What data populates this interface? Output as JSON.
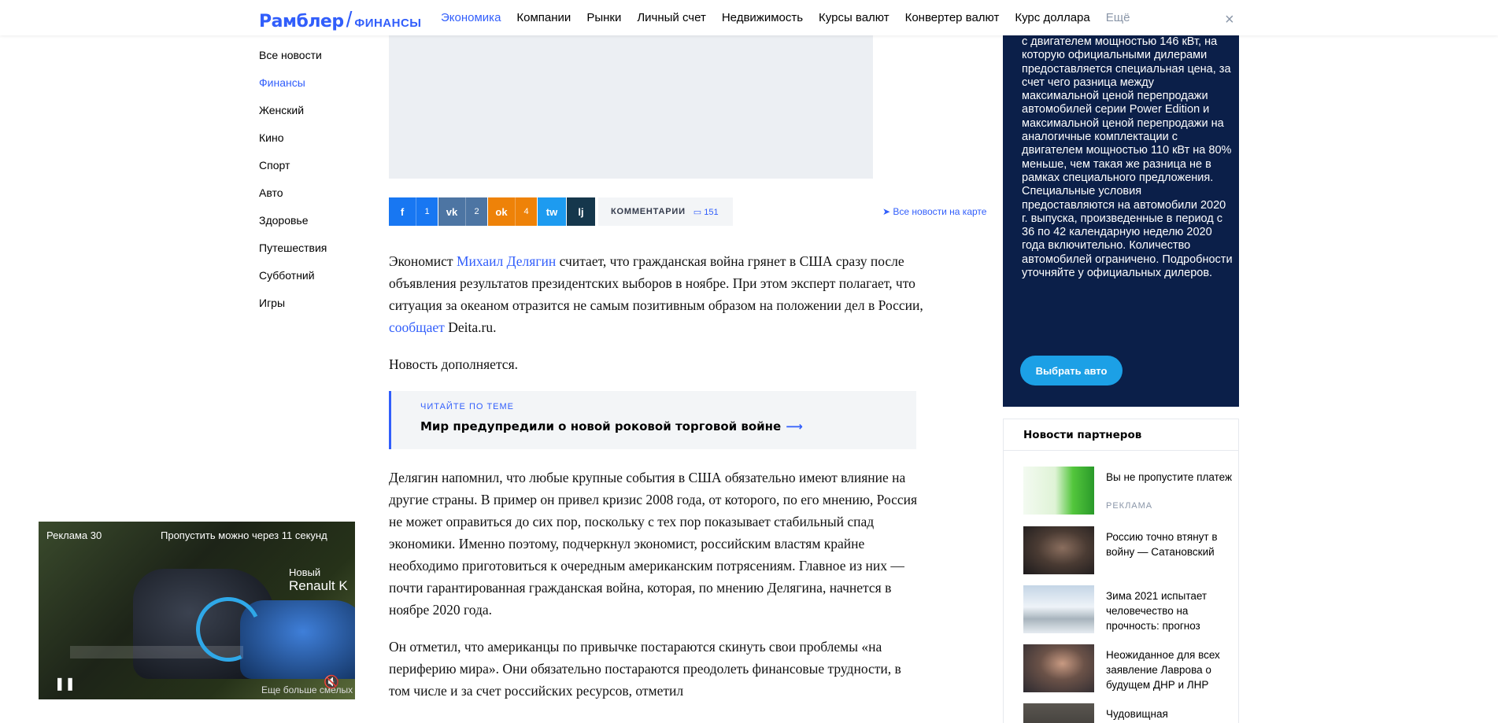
{
  "header": {
    "logo_main": "Рамблер",
    "logo_slash": "/",
    "logo_sub": "ФИНАНСЫ",
    "nav": [
      {
        "label": "Экономика",
        "active": true
      },
      {
        "label": "Компании"
      },
      {
        "label": "Рынки"
      },
      {
        "label": "Личный счет"
      },
      {
        "label": "Недвижимость"
      },
      {
        "label": "Курсы валют"
      },
      {
        "label": "Конвертер валют"
      },
      {
        "label": "Курс доллара"
      },
      {
        "label": "Ещё"
      }
    ],
    "close_icon": "×"
  },
  "sidebar": {
    "items": [
      {
        "label": "Все новости"
      },
      {
        "label": "Финансы",
        "active": true
      },
      {
        "label": "Женский"
      },
      {
        "label": "Кино"
      },
      {
        "label": "Спорт"
      },
      {
        "label": "Авто"
      },
      {
        "label": "Здоровье"
      },
      {
        "label": "Путешествия"
      },
      {
        "label": "Субботний"
      },
      {
        "label": "Игры"
      }
    ]
  },
  "share": {
    "fb_icon": "f",
    "fb_count": "1",
    "vk_icon": "vk",
    "vk_count": "2",
    "ok_icon": "ok",
    "ok_count": "4",
    "tw_icon": "tw",
    "lj_icon": "lj",
    "comments_label": "КОММЕНТАРИИ",
    "comments_count": "151",
    "map_link": "Все новости на карте"
  },
  "article": {
    "p1_a": "Экономист ",
    "p1_link1": "Михаил Делягин",
    "p1_b": " считает, что гражданская война грянет в США сразу после объявления результатов президентских выборов в ноябре. При этом эксперт полагает, что ситуация за океаном отразится не самым позитивным образом на положении дел в России, ",
    "p1_link2": "сообщает",
    "p1_c": " Deita.ru.",
    "p2": "Новость дополняется.",
    "read_also_title": "ЧИТАЙТЕ ПО ТЕМЕ",
    "read_also_link": "Мир предупредили о новой роковой торговой войне",
    "p3": "Делягин напомнил, что любые крупные события в США обязательно имеют влияние на другие страны. В пример он привел кризис 2008 года, от которого, по его мнению, Россия не может оправиться до сих пор, поскольку с тех пор показывает стабильный спад экономики. Именно поэтому, подчеркнул экономист, российским властям крайне необходимо приготовиться к очередным американским потрясениям. Главное из них — почти гарантированная гражданская война, которая, по мнению Делягина, начнется в ноябре 2020 года.",
    "p4": "Он отметил, что американцы по привычке постараются скинуть свои проблемы «на периферию мира». Они обязательно постараются преодолеть финансовые трудности, в том числе и за счет российских ресурсов, отметил"
  },
  "dark_ad": {
    "text": "с двигателем мощностью 146 кВт, на которую официальными дилерами предоставляется специальная цена, за счет чего разница между максимальной ценой перепродажи автомобилей серии Power Edition и максимальной ценой перепродажи на аналогичные комплектации с двигателем мощностью 110  кВт на 80% меньше, чем такая же разница не в рамках специального предложения.   Специальные условия предоставляются на автомобили 2020 г. выпуска, произведенные в период с 36 по 42 календарную неделю 2020 года включительно. Количество автомобилей ограничено. Подробности уточняйте у официальных дилеров.",
    "button": "Выбрать авто"
  },
  "partners": {
    "title": "Новости партнеров",
    "items": [
      {
        "text": "Вы не пропустите платеж",
        "tag": "РЕКЛАМА"
      },
      {
        "text": "Россию точно втянут в войну — Сатановский"
      },
      {
        "text": "Зима 2021 испытает человечество на прочность: прогноз"
      },
      {
        "text": "Неожиданное для всех заявление Лаврова о будущем ДНР и ЛНР"
      },
      {
        "text": "Чудовищная"
      }
    ]
  },
  "video_ad": {
    "ad_label": "Реклама 30",
    "skip_label": "Пропустить можно через 11 секунд",
    "brand_small": "Новый",
    "brand_big": "Renault K",
    "more": "Еще больше смелых",
    "pause_icon": "❚❚",
    "mute_icon": "🔇"
  },
  "colors": {
    "accent": "#315efb",
    "dark_ad_bg": "#0b1f49",
    "ad_button": "#1ca0e6"
  }
}
